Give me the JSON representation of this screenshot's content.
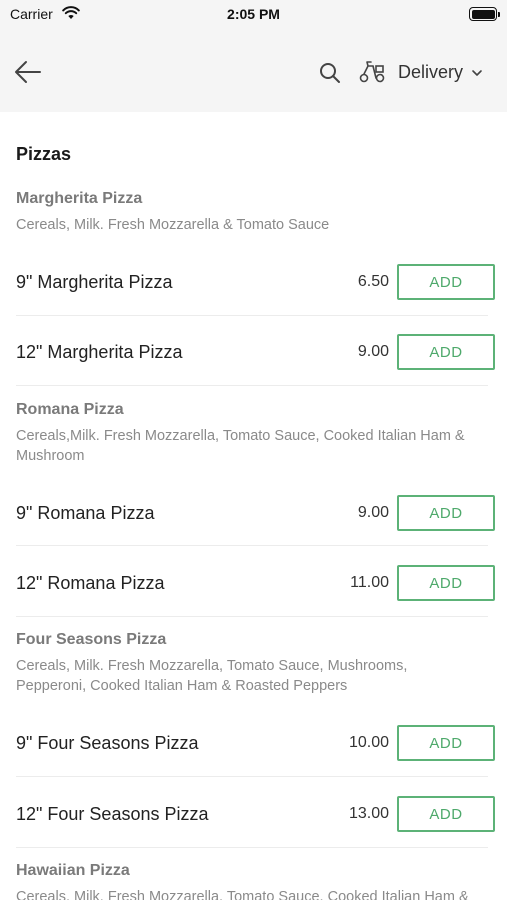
{
  "status_bar": {
    "carrier": "Carrier",
    "time": "2:05 PM"
  },
  "nav": {
    "back_icon": "arrow-left-icon",
    "search_icon": "search-icon",
    "delivery_icon": "scooter-icon",
    "delivery_label": "Delivery",
    "dropdown_icon": "chevron-down-icon"
  },
  "section": {
    "title": "Pizzas"
  },
  "groups": [
    {
      "name": "Margherita Pizza",
      "desc_lines": [
        "Cereals, Milk. Fresh Mozzarella & Tomato Sauce"
      ],
      "items": [
        {
          "name": "9\" Margherita Pizza",
          "price": "6.50",
          "add_label": "ADD"
        },
        {
          "name": "12\" Margherita Pizza",
          "price": "9.00",
          "add_label": "ADD"
        }
      ]
    },
    {
      "name": "Romana Pizza",
      "desc_lines": [
        "Cereals,Milk. Fresh Mozzarella, Tomato Sauce, Cooked Italian Ham &",
        "Mushroom"
      ],
      "items": [
        {
          "name": "9\" Romana Pizza",
          "price": "9.00",
          "add_label": "ADD"
        },
        {
          "name": "12\" Romana Pizza",
          "price": "11.00",
          "add_label": "ADD"
        }
      ]
    },
    {
      "name": "Four Seasons Pizza",
      "desc_lines": [
        "Cereals, Milk. Fresh Mozzarella, Tomato Sauce, Mushrooms,",
        "Pepperoni, Cooked Italian Ham & Roasted Peppers"
      ],
      "items": [
        {
          "name": "9\" Four Seasons Pizza",
          "price": "10.00",
          "add_label": "ADD"
        },
        {
          "name": "12\" Four Seasons Pizza",
          "price": "13.00",
          "add_label": "ADD"
        }
      ]
    },
    {
      "name": "Hawaiian Pizza",
      "desc_lines": [
        "Cereals, Milk. Fresh Mozzarella, Tomato Sauce, Cooked Italian Ham &"
      ],
      "items": []
    }
  ],
  "colors": {
    "accent": "#5cb277",
    "header_bg": "#f5f5f5"
  }
}
